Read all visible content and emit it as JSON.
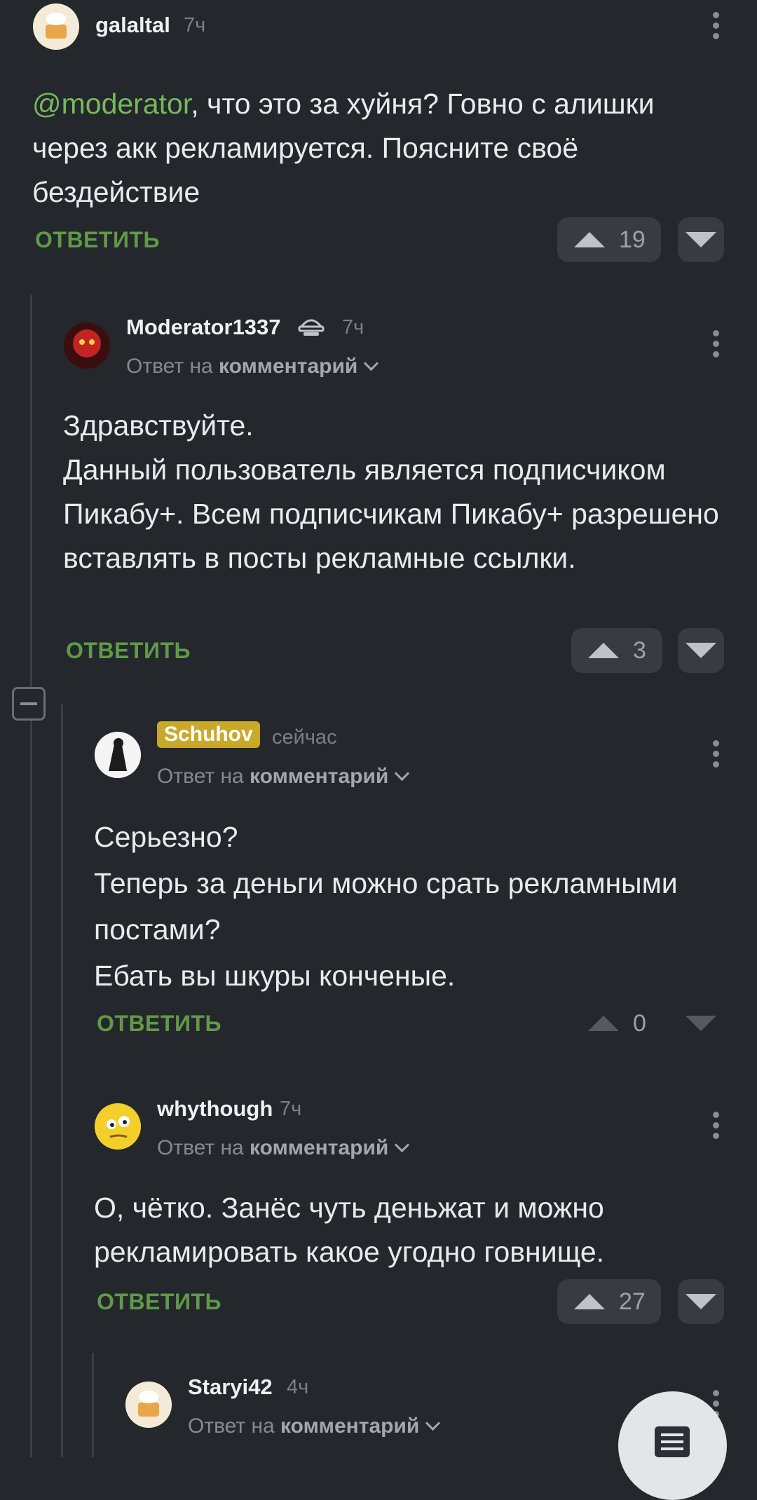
{
  "colors": {
    "accent": "#76b95c",
    "reply": "#5f9a48",
    "badge": "#c9a92a",
    "background": "#24272b"
  },
  "comments": [
    {
      "author": "galaltal",
      "time": "7ч",
      "mention": "@moderator",
      "text_after_mention": ", что это за хуйня? Говно с алишки через акк рекламируется. Поясните своё бездействие",
      "reply_label": "ОТВЕТИТЬ",
      "rating": "19"
    },
    {
      "author": "Moderator1337",
      "time": "7ч",
      "reply_prefix": "Ответ на",
      "reply_target": "комментарий",
      "text": "Здравствуйте.\nДанный пользователь является подписчиком Пикабу+. Всем подписчикам Пикабу+ разрешено вставлять в посты рекламные ссылки.",
      "reply_label": "ОТВЕТИТЬ",
      "rating": "3"
    },
    {
      "author": "Schuhov",
      "time": "сейчас",
      "reply_prefix": "Ответ на",
      "reply_target": "комментарий",
      "text": "Серьезно?\nТеперь за деньги можно срать рекламными постами?\nЕбать вы шкуры конченые.",
      "reply_label": "ОТВЕТИТЬ",
      "rating": "0"
    },
    {
      "author": "whythough",
      "time": "7ч",
      "reply_prefix": "Ответ на",
      "reply_target": "комментарий",
      "text": "О, чётко. Занёс чуть деньжат и можно рекламировать какое угодно говнище.",
      "reply_label": "ОТВЕТИТЬ",
      "rating": "27"
    },
    {
      "author": "Staryi42",
      "time": "4ч",
      "reply_prefix": "Ответ на",
      "reply_target": "комментарий"
    }
  ]
}
